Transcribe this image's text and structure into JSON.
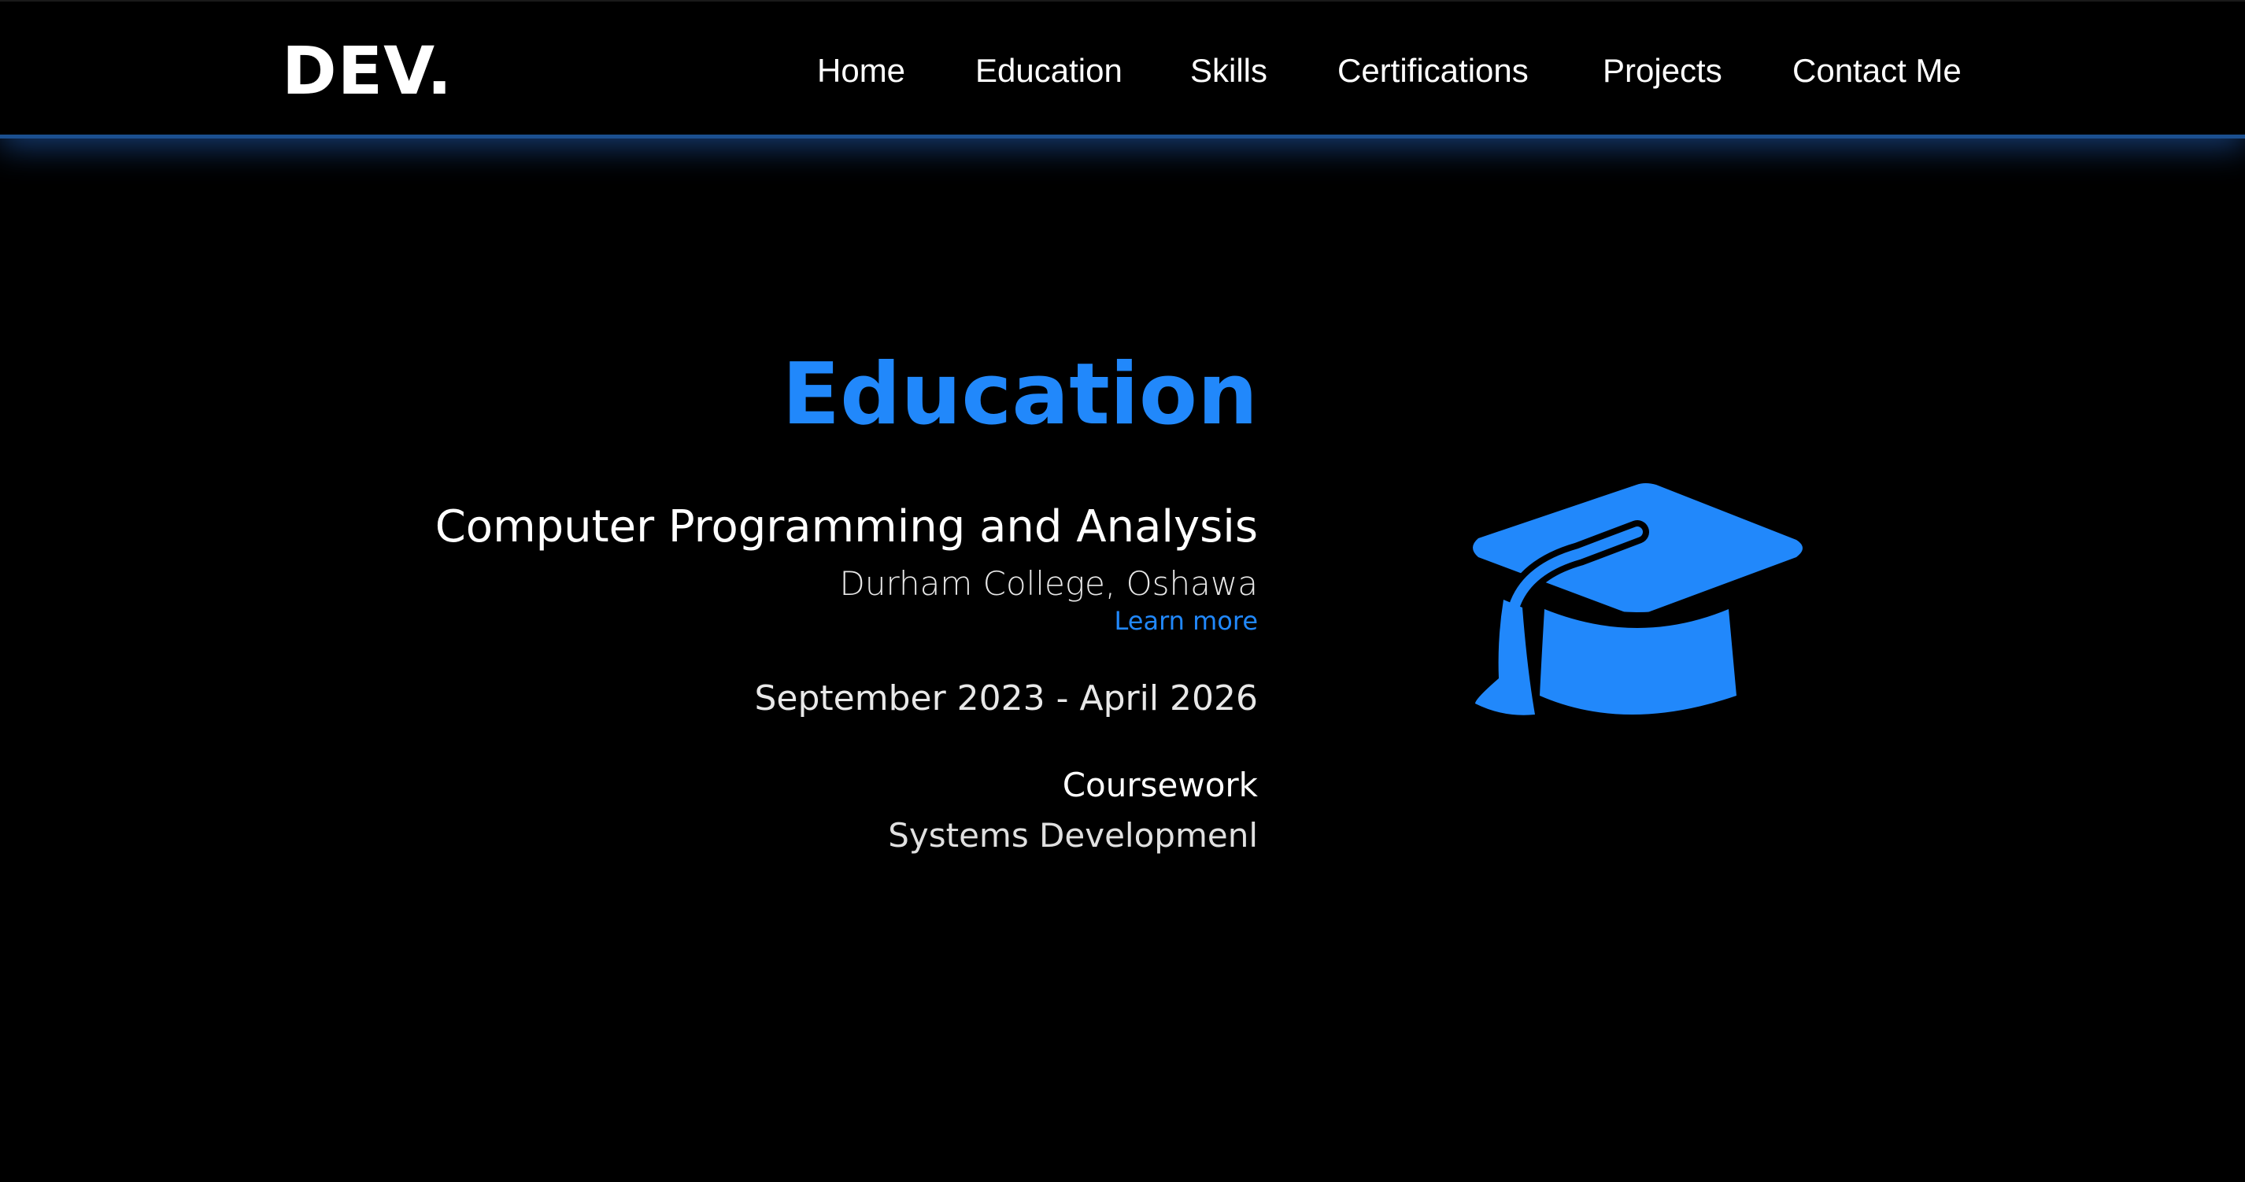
{
  "logo": "DEV.",
  "nav": {
    "home": "Home",
    "education": "Education",
    "skills": "Skills",
    "certifications": "Certifications",
    "projects": "Projects",
    "contact": "Contact Me"
  },
  "education": {
    "title": "Education",
    "program": "Computer Programming and Analysis",
    "school": "Durham College, Oshawa",
    "learn_more": "Learn more",
    "dates": "September 2023 - April 2026",
    "coursework_label": "Coursework",
    "coursework_item": "Systems Developmenl"
  },
  "icons": {
    "education": "graduation-cap-icon"
  },
  "colors": {
    "accent": "#2188fb",
    "background": "#000000",
    "text": "#ffffff"
  }
}
